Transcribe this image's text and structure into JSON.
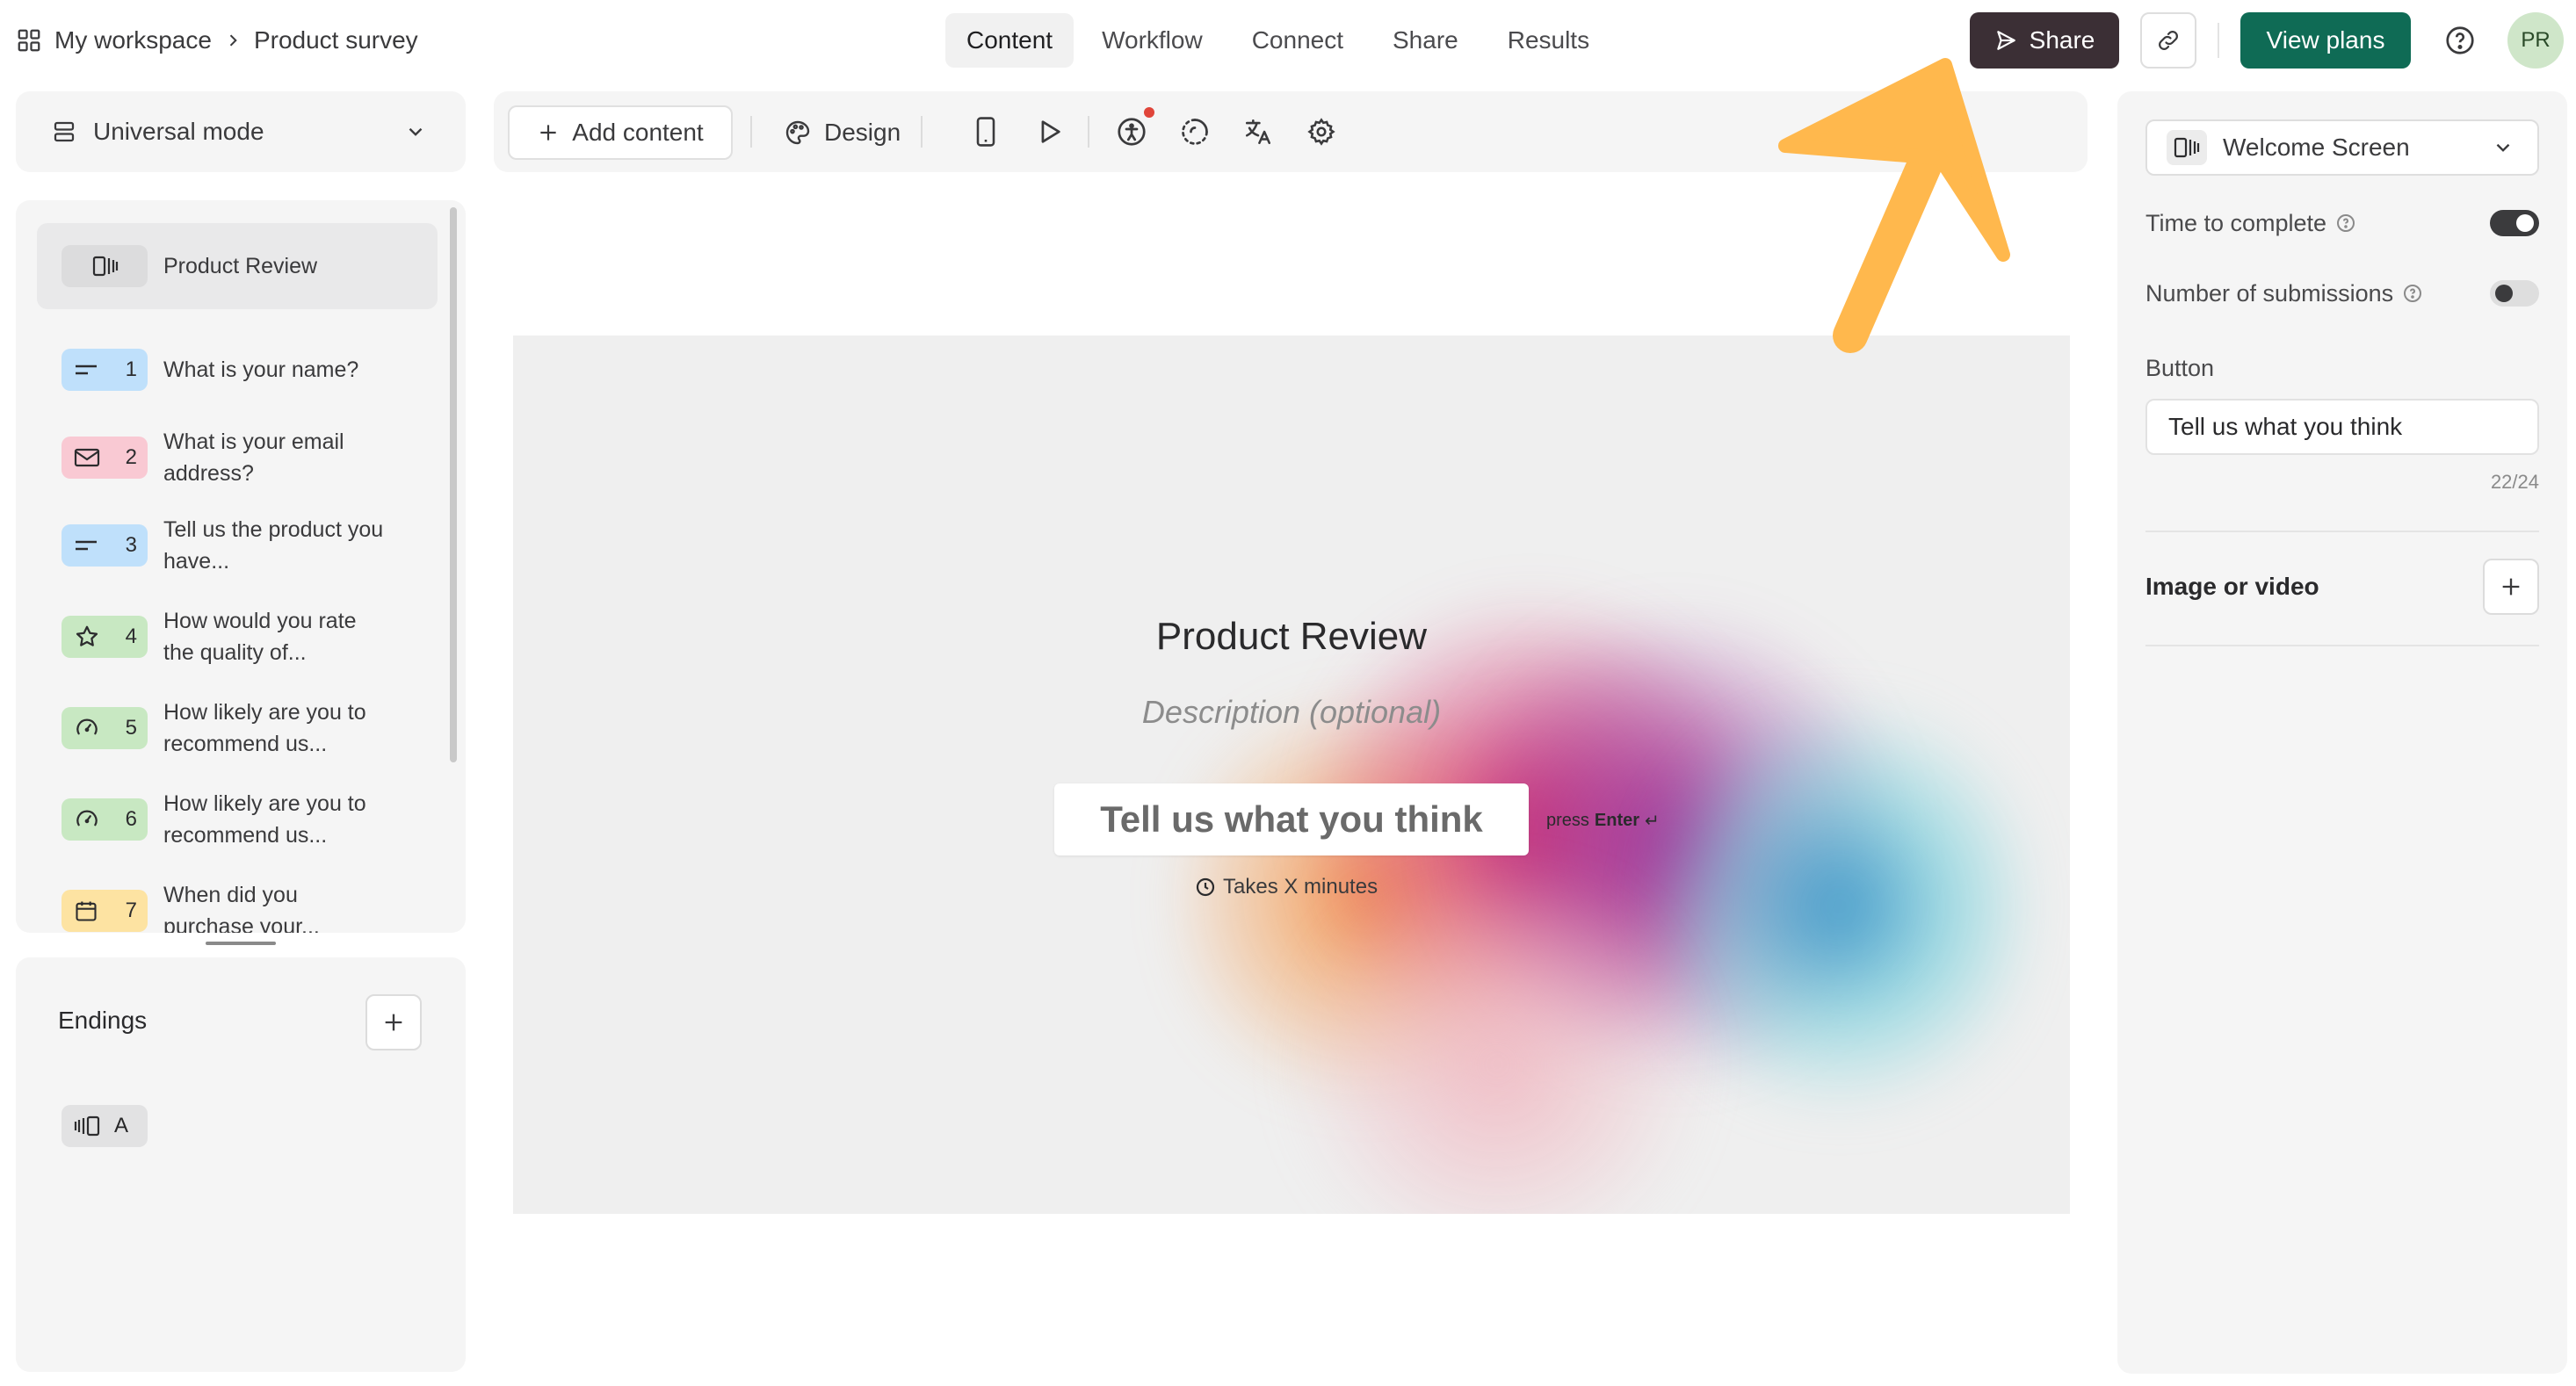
{
  "breadcrumb": {
    "workspace": "My workspace",
    "current": "Product survey"
  },
  "tabs": [
    "Content",
    "Workflow",
    "Connect",
    "Share",
    "Results"
  ],
  "header": {
    "share_label": "Share",
    "plans_label": "View plans",
    "avatar_initials": "PR"
  },
  "mode": {
    "label": "Universal mode"
  },
  "questions": [
    {
      "num": "",
      "text": "Product Review",
      "icon": "welcome-screen-icon",
      "color": "#e2e2e3"
    },
    {
      "num": "1",
      "text": "What is your name?",
      "icon": "short-text-icon",
      "color": "#bfe0fb"
    },
    {
      "num": "2",
      "text": "What is your email address?",
      "icon": "mail-icon",
      "color": "#f9c9d3"
    },
    {
      "num": "3",
      "text": "Tell us the product you have...",
      "icon": "short-text-icon",
      "color": "#bfe0fb"
    },
    {
      "num": "4",
      "text": "How would you rate the quality of...",
      "icon": "star-icon",
      "color": "#c8e8c2"
    },
    {
      "num": "5",
      "text": "How likely are you to recommend us...",
      "icon": "gauge-icon",
      "color": "#c8e8c2"
    },
    {
      "num": "6",
      "text": "How likely are you to recommend us...",
      "icon": "gauge-icon",
      "color": "#c8e8c2"
    },
    {
      "num": "7",
      "text": "When did you purchase your...",
      "icon": "calendar-icon",
      "color": "#fde3a2"
    }
  ],
  "endings": {
    "title": "Endings",
    "items": [
      {
        "label": "A",
        "icon": "ending-screen-icon"
      }
    ]
  },
  "toolbar": {
    "add_label": "Add content",
    "design_label": "Design"
  },
  "canvas": {
    "title": "Product Review",
    "description": "Description (optional)",
    "button": "Tell us what you think",
    "press_prefix": "press",
    "press_key": "Enter",
    "press_symbol": "↵",
    "time_text": "Takes X minutes"
  },
  "settings": {
    "screen_select": "Welcome Screen",
    "time_to_complete": {
      "label": "Time to complete",
      "on": true
    },
    "submissions": {
      "label": "Number of submissions",
      "on": false
    },
    "button_label": "Button",
    "button_value": "Tell us what you think",
    "char_count": "22/24",
    "media_label": "Image or video"
  },
  "colors": {
    "accent_dark": "#3b2f35",
    "plans_green": "#0f6b55",
    "arrow": "#ffb84d"
  }
}
